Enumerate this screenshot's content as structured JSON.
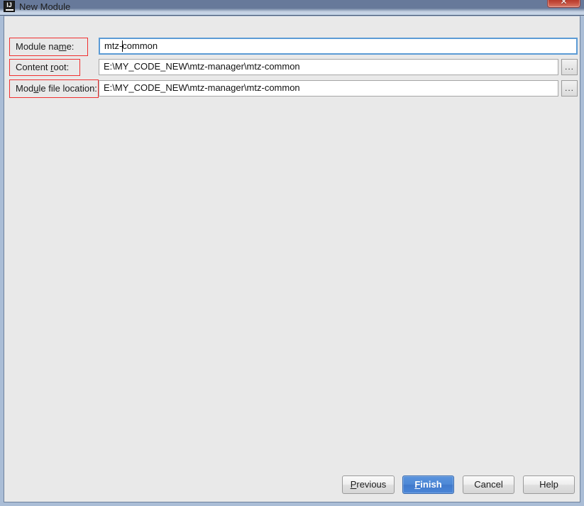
{
  "window": {
    "title": "New Module",
    "icon": "intellij-idea-icon",
    "close_label": "✕"
  },
  "form": {
    "rows": [
      {
        "label_prefix": "Module na",
        "label_mnemonic": "m",
        "label_suffix": "e:",
        "value": "mtz-common",
        "focused": true,
        "has_browse": false,
        "browse_label": ""
      },
      {
        "label_prefix": "Content ",
        "label_mnemonic": "r",
        "label_suffix": "oot:",
        "value": "E:\\MY_CODE_NEW\\mtz-manager\\mtz-common",
        "focused": false,
        "has_browse": true,
        "browse_label": "..."
      },
      {
        "label_prefix": "Mod",
        "label_mnemonic": "u",
        "label_suffix": "le file location:",
        "value": "E:\\MY_CODE_NEW\\mtz-manager\\mtz-common",
        "focused": false,
        "has_browse": true,
        "browse_label": "..."
      }
    ]
  },
  "buttons": {
    "previous": {
      "prefix": "",
      "mnemonic": "P",
      "suffix": "revious",
      "default": false
    },
    "finish": {
      "prefix": "",
      "mnemonic": "F",
      "suffix": "inish",
      "default": true
    },
    "cancel": {
      "prefix": "Cancel",
      "mnemonic": "",
      "suffix": "",
      "default": false
    },
    "help": {
      "prefix": "Help",
      "mnemonic": "",
      "suffix": "",
      "default": false
    }
  },
  "colors": {
    "accent_blue": "#4a86d8",
    "highlight_red": "#f03030",
    "dialog_bg": "#e9e9e9",
    "focus_border": "#5b9bd5"
  }
}
